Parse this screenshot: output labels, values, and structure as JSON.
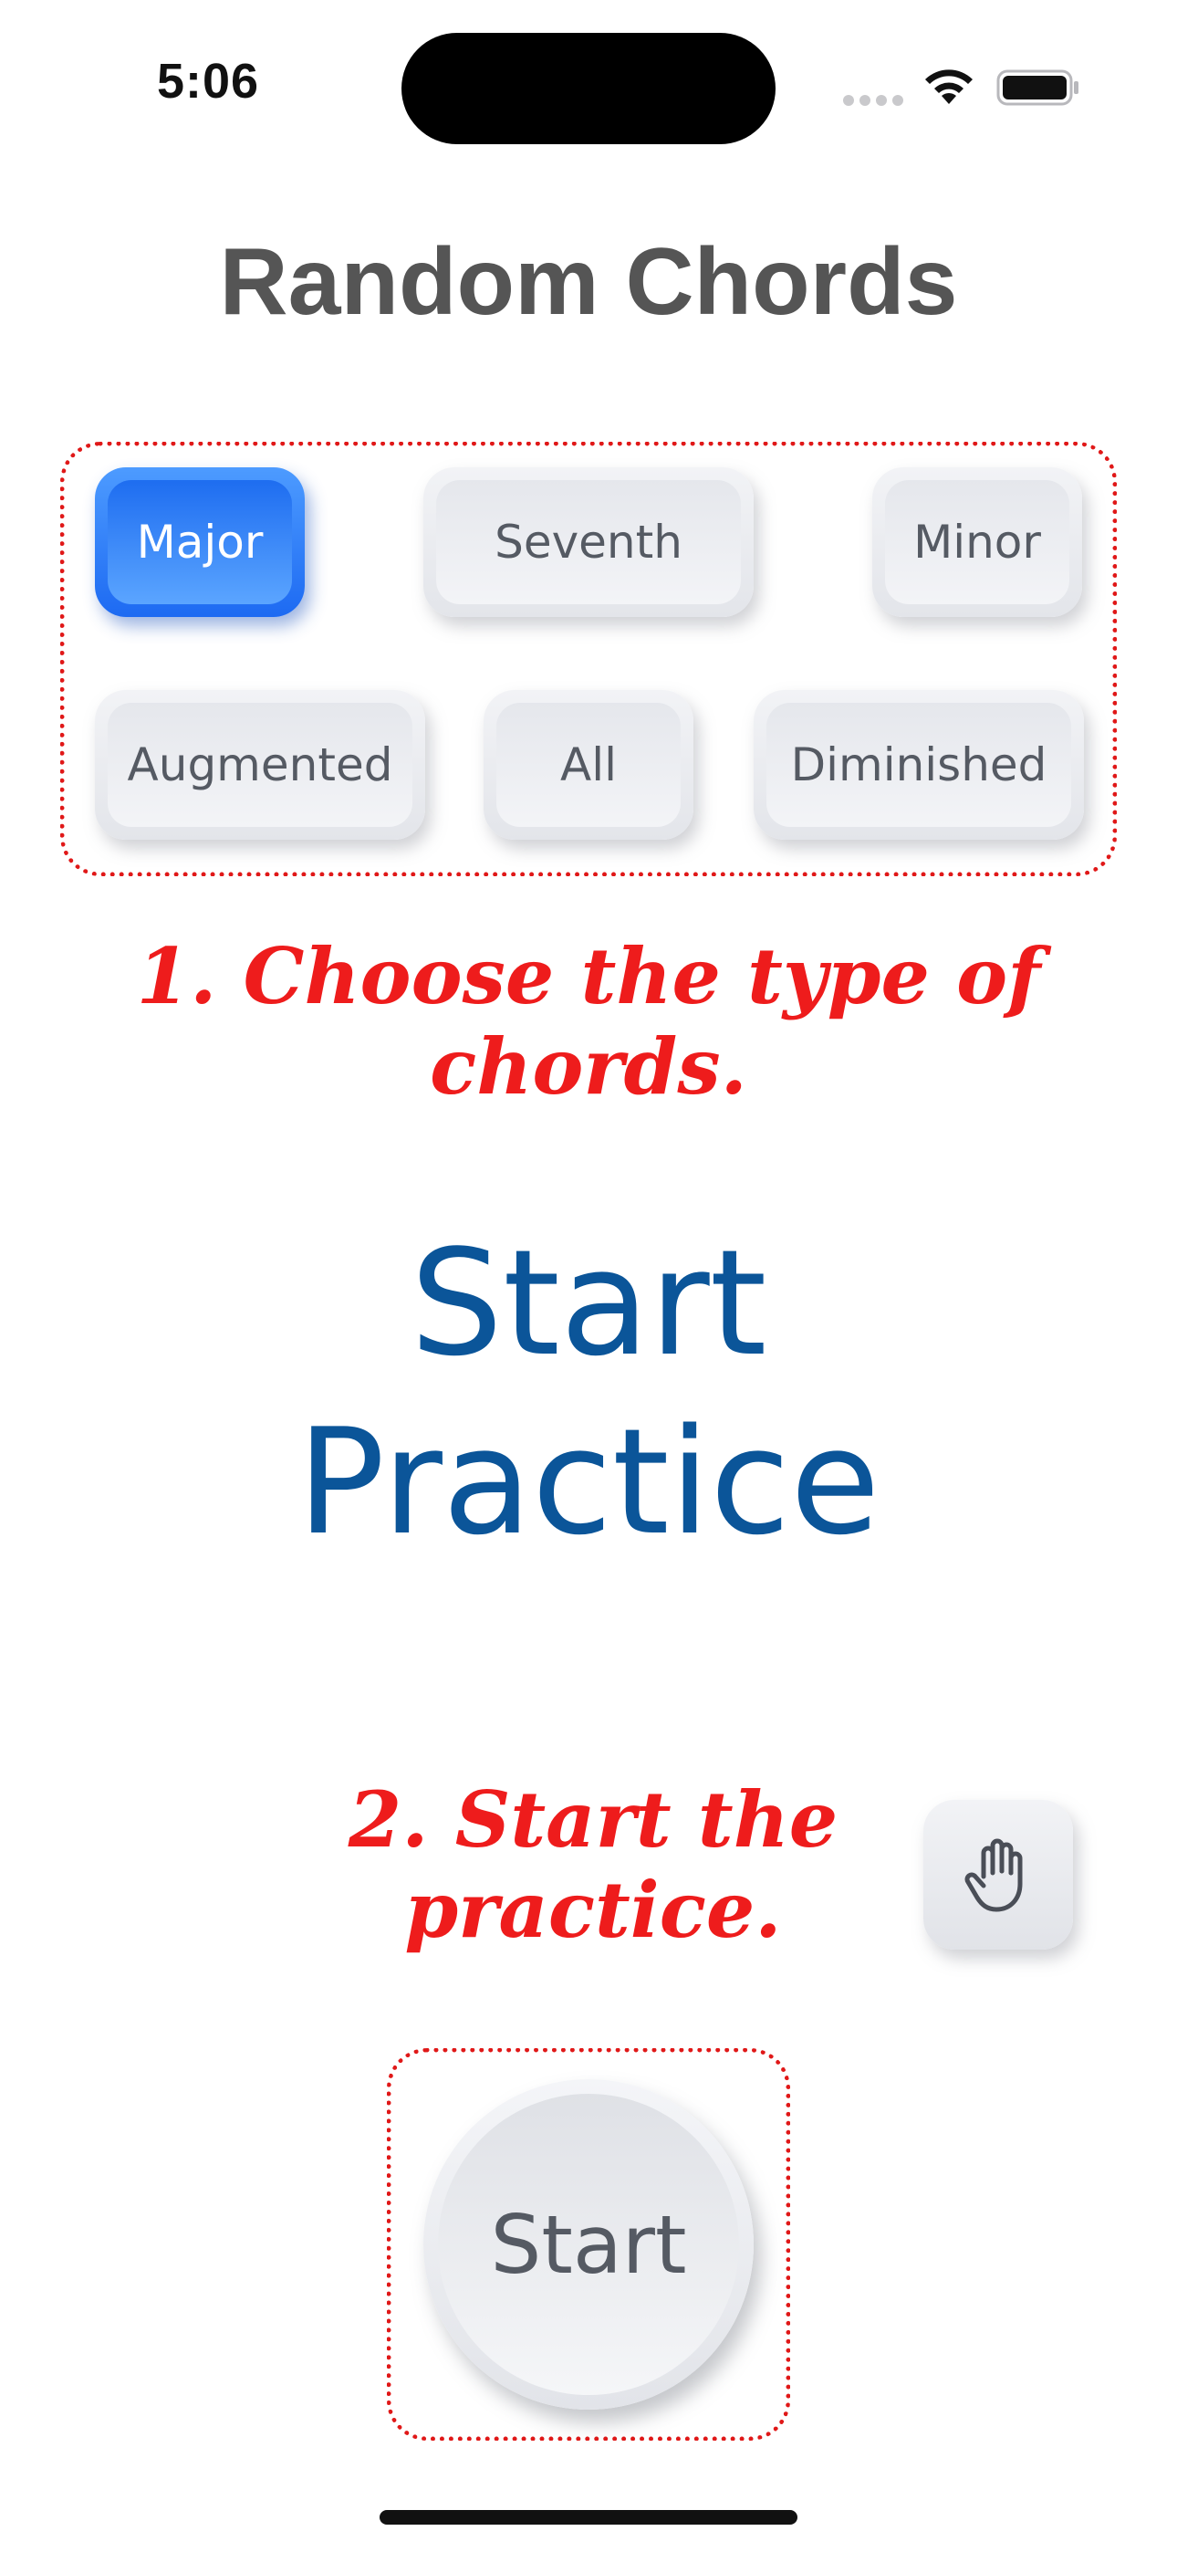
{
  "status_bar": {
    "time": "5:06",
    "icons": [
      "cellular-signal-icon",
      "wifi-icon",
      "battery-icon"
    ]
  },
  "header": {
    "title": "Random Chords"
  },
  "chord_types": {
    "selected": "Major",
    "items": [
      {
        "label": "Major"
      },
      {
        "label": "Seventh"
      },
      {
        "label": "Minor"
      },
      {
        "label": "Augmented"
      },
      {
        "label": "All"
      },
      {
        "label": "Diminished"
      }
    ]
  },
  "annotations": {
    "step1": "1. Choose the type of chords.",
    "step2": "2. Start the practice."
  },
  "display": {
    "line1": "Start",
    "line2": "Practice"
  },
  "controls": {
    "stop_icon": "hand-raised-icon",
    "start_label": "Start"
  },
  "colors": {
    "accent": "#1d6af2",
    "display_text": "#0b5599",
    "annotation": "#ee1c1c"
  }
}
